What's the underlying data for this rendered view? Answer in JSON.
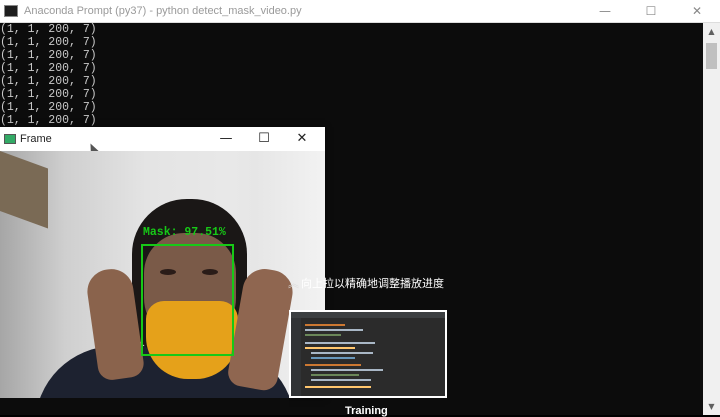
{
  "console": {
    "title": "Anaconda Prompt (py37) - python  detect_mask_video.py",
    "lines": [
      "(1, 1, 200, 7)",
      "(1, 1, 200, 7)",
      "(1, 1, 200, 7)",
      "(1, 1, 200, 7)",
      "(1, 1, 200, 7)",
      "(1, 1, 200, 7)",
      "(1, 1, 200, 7)",
      "(1, 1, 200, 7)"
    ],
    "controls": {
      "minimize": "—",
      "maximize": "☐",
      "close": "✕"
    }
  },
  "frame_window": {
    "title": "Frame",
    "controls": {
      "minimize": "—",
      "maximize": "☐",
      "close": "✕"
    },
    "detection": {
      "label": "Mask: 97.51%",
      "color": "#17c917"
    }
  },
  "overlay": {
    "tooltip": "向上拉以精确地调整播放进度",
    "tooltip_icon": "chevron-up-double-icon",
    "caption": "Training"
  },
  "colors": {
    "console_bg": "#0c0c0c",
    "console_text": "#c8c8c8",
    "mask_yellow": "#e5a11a"
  }
}
